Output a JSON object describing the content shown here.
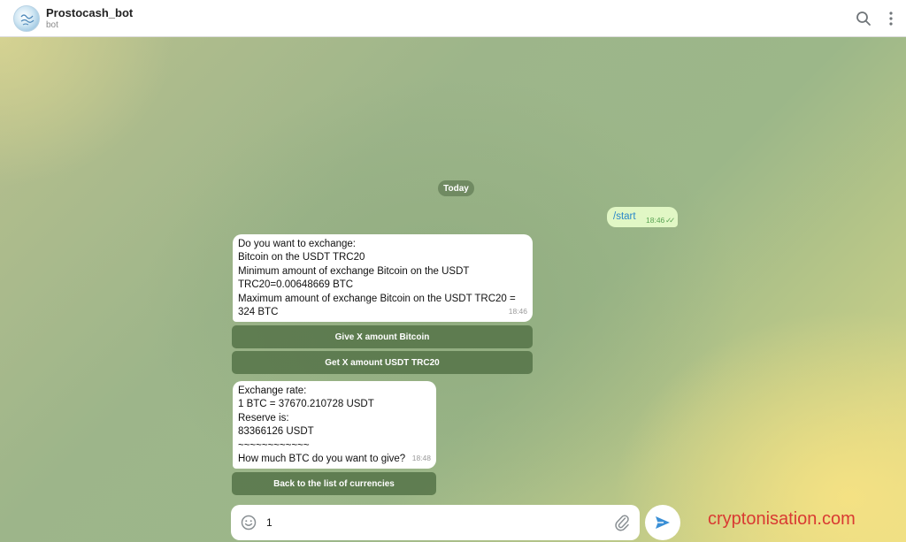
{
  "header": {
    "title": "Prostocash_bot",
    "subtitle": "bot",
    "avatar_icon": "prostocash-logo-icon",
    "search_icon": "search-icon",
    "more_icon": "more-vertical-icon"
  },
  "chat": {
    "date_separator": "Today",
    "outgoing": {
      "text": "/start",
      "time": "18:46",
      "status": "read-double-check"
    },
    "message1": {
      "lines": [
        "Do you want to exchange:",
        "Bitcoin on the USDT TRC20",
        "Minimum amount of exchange Bitcoin on the USDT",
        "TRC20=0.00648669 BTC",
        "Maximum  amount of exchange Bitcoin on the USDT TRC20 =",
        "324 BTC"
      ],
      "time": "18:46"
    },
    "keyboard1": [
      "Give X amount Bitcoin",
      "Get X amount USDT TRC20"
    ],
    "message2": {
      "lines": [
        "Exchange rate:",
        "1 BTC = 37670.210728 USDT",
        "Reserve is:",
        "83366126 USDT",
        "~~~~~~~~~~~~",
        "How much BTC do you want to give?"
      ],
      "time": "18:48"
    },
    "keyboard2": [
      "Back to the list of currencies"
    ]
  },
  "composer": {
    "value": "1",
    "emoji_icon": "emoji-icon",
    "attach_icon": "paperclip-icon",
    "send_icon": "send-icon"
  },
  "watermark": "cryptonisation.com",
  "colors": {
    "outgoing_bubble": "#e1f7c5",
    "incoming_bubble": "#ffffff",
    "keyboard_button": "#557348",
    "accent": "#3a8fd6",
    "watermark": "#d93a32"
  }
}
